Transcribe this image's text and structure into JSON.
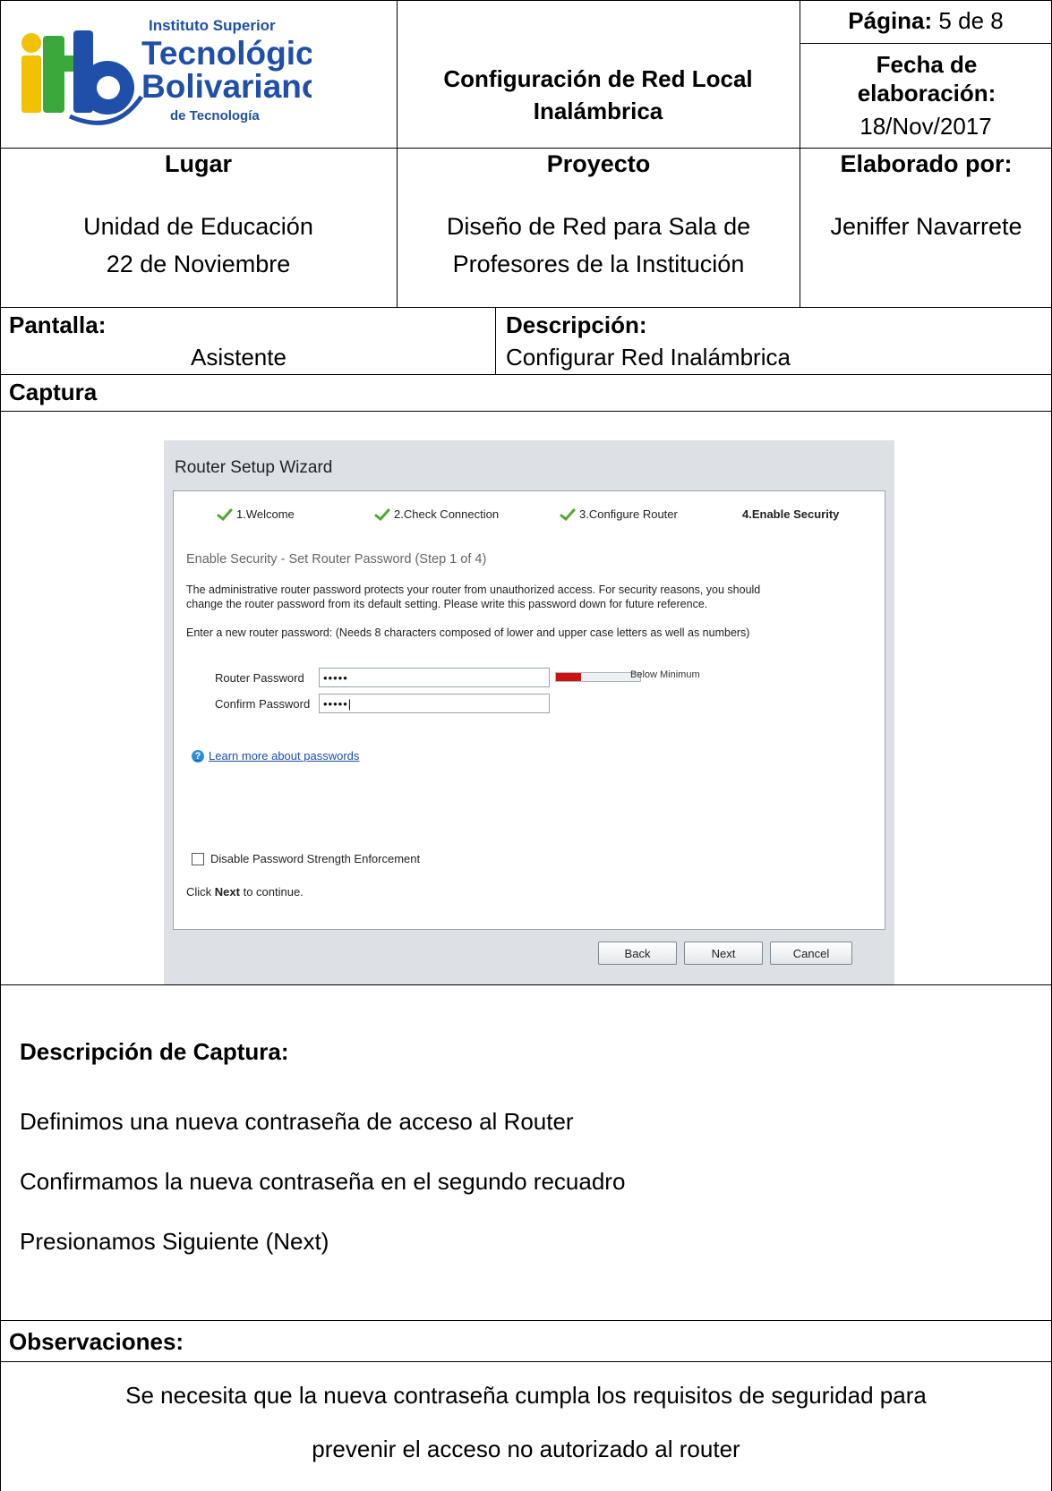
{
  "header": {
    "logo": {
      "line1": "Instituto Superior",
      "line2": "Tecnológico",
      "line3": "Bolivariano",
      "line4": "de Tecnología",
      "mark": "itb"
    },
    "title": "Configuración de Red Local Inalámbrica",
    "pagina_label": "Página:",
    "pagina_value": "5 de 8",
    "fecha_label": "Fecha de elaboración:",
    "fecha_value": "18/Nov/2017"
  },
  "info": {
    "lugar_label": "Lugar",
    "lugar_line1": "Unidad de Educación",
    "lugar_line2": "22 de Noviembre",
    "proyecto_label": "Proyecto",
    "proyecto_line1": "Diseño de Red para Sala de",
    "proyecto_line2": "Profesores de la Institución",
    "elaborado_label": "Elaborado por:",
    "elaborado_value": "Jeniffer Navarrete"
  },
  "pantalla": {
    "label": "Pantalla:",
    "value": "Asistente",
    "desc_label": "Descripción:",
    "desc_value": "Configurar Red Inalámbrica"
  },
  "captura_label": "Captura",
  "wizard": {
    "title": "Router Setup Wizard",
    "steps": [
      "1.Welcome",
      "2.Check Connection",
      "3.Configure Router",
      "4.Enable Security"
    ],
    "subtitle": "Enable Security - Set Router Password (Step 1 of 4)",
    "para1": "The administrative router password protects your router from unauthorized access. For security reasons, you should",
    "para2": "change the router password from its default setting. Please write this password down for future reference.",
    "para3": "Enter a new router password: (Needs 8 characters composed of lower and upper case letters as well as numbers)",
    "router_password_label": "Router Password",
    "router_password_value": "•••••",
    "confirm_password_label": "Confirm Password",
    "confirm_password_value": "•••••|",
    "strength_text": "Below Minimum",
    "strength_level": 0.3,
    "strength_color": "#cc1111",
    "help_link": "Learn more about passwords",
    "help_icon": "question-icon",
    "checkbox_label": "Disable Password Strength Enforcement",
    "checkbox_checked": false,
    "click_prefix": "Click ",
    "click_bold": "Next",
    "click_suffix": " to continue.",
    "back": "Back",
    "next": "Next",
    "cancel": "Cancel"
  },
  "descripcion": {
    "label": "Descripción de Captura:",
    "lines": [
      "Definimos una nueva contraseña de acceso al Router",
      "Confirmamos la nueva contraseña en el segundo recuadro",
      "Presionamos Siguiente (Next)"
    ]
  },
  "observaciones": {
    "label": "Observaciones:",
    "line1": "Se necesita que la nueva contraseña cumpla los requisitos de seguridad para",
    "line2": "prevenir el acceso no autorizado al router"
  }
}
